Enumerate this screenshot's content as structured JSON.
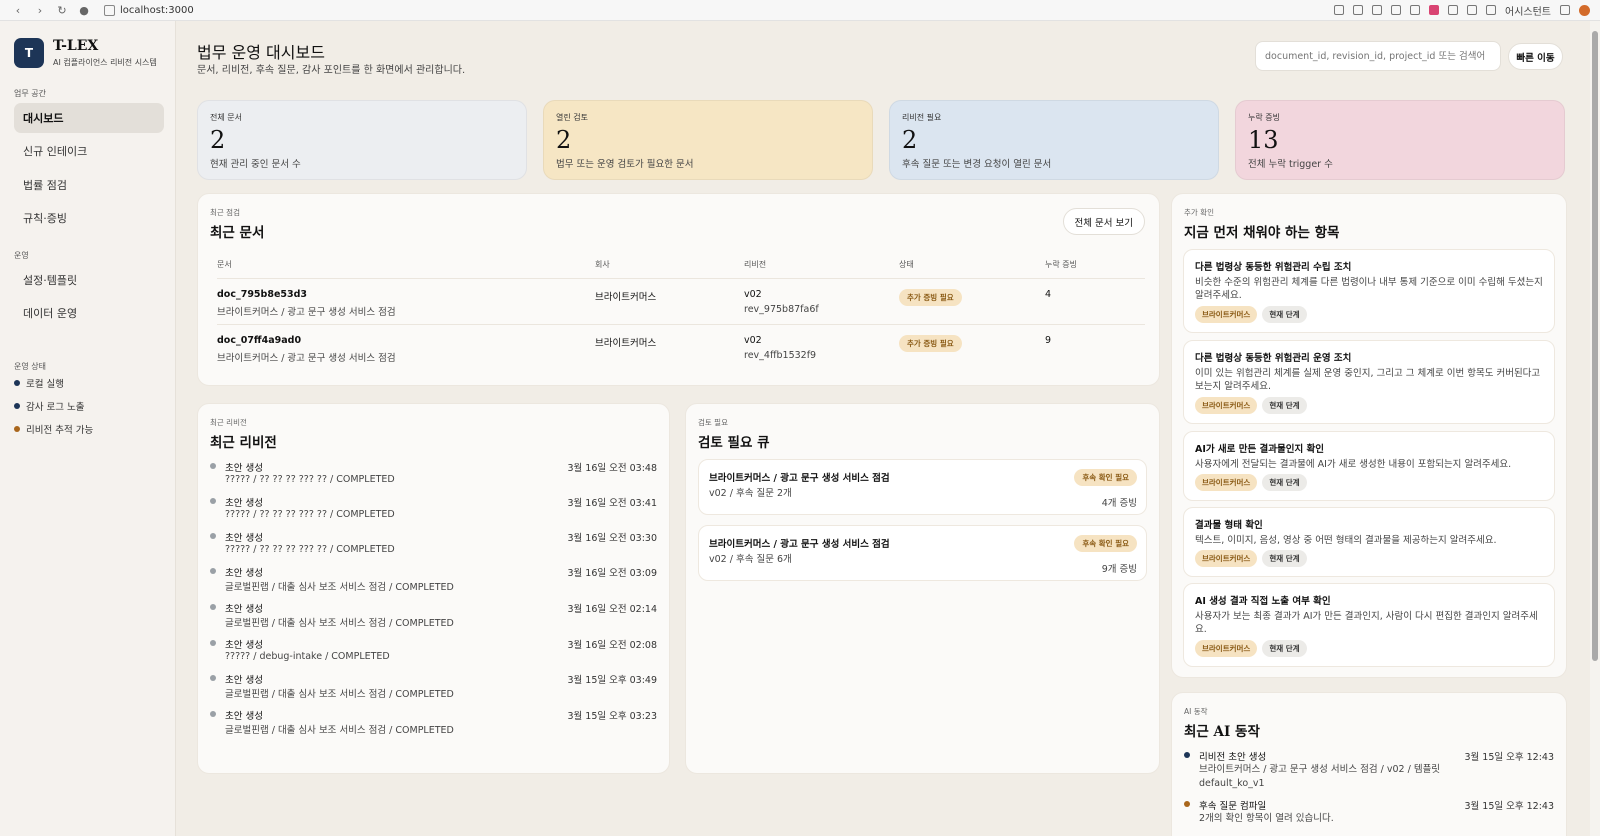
{
  "browser": {
    "url": "localhost:3000",
    "assistant_label": "어시스턴트"
  },
  "sidebar": {
    "logo_letter": "T",
    "brand": "T-LEX",
    "brand_sub": "AI 컴플라이언스 리비전 시스템",
    "section_workspace": "업무 공간",
    "workspace_items": [
      {
        "label": "대시보드",
        "active": true
      },
      {
        "label": "신규 인테이크"
      },
      {
        "label": "법률 점검"
      },
      {
        "label": "규칙·증빙"
      }
    ],
    "section_ops": "운영",
    "ops_items": [
      {
        "label": "설정·템플릿"
      },
      {
        "label": "데이터 운영"
      }
    ],
    "section_status": "운영 상태",
    "status_items": [
      {
        "label": "로컬 실행",
        "color": "#1d3557"
      },
      {
        "label": "감사 로그 노출",
        "color": "#1d3557"
      },
      {
        "label": "리비전 추적 가능",
        "color": "#a9661c"
      }
    ]
  },
  "header": {
    "title": "법무 운영 대시보드",
    "subtitle": "문서, 리비전, 후속 질문, 감사 포인트를 한 화면에서 관리합니다.",
    "search_placeholder": "document_id, revision_id, project_id 또는 검색어",
    "quick_button": "빠른 이동"
  },
  "stats": [
    {
      "label": "전체 문서",
      "value": "2",
      "desc": "현재 관리 중인 문서 수",
      "color": "#eceef1"
    },
    {
      "label": "열린 검토",
      "value": "2",
      "desc": "법무 또는 운영 검토가 필요한 문서",
      "color": "#f6e6c4"
    },
    {
      "label": "리비전 필요",
      "value": "2",
      "desc": "후속 질문 또는 변경 요청이 열린 문서",
      "color": "#dbe5f0"
    },
    {
      "label": "누락 증빙",
      "value": "13",
      "desc": "전체 누락 trigger 수",
      "color": "#f2d6dd"
    }
  ],
  "recent_docs": {
    "eyebrow": "최근 점검",
    "title": "최근 문서",
    "button": "전체 문서 보기",
    "columns": [
      "문서",
      "회사",
      "리비전",
      "상태",
      "누락 증빙"
    ],
    "rows": [
      {
        "doc_id": "doc_795b8e53d3",
        "doc_name": "브라이트커머스 / 광고 문구 생성 서비스 점검",
        "company": "브라이트커머스",
        "rev": "v02",
        "rev_id": "rev_975b87fa6f",
        "status": "추가 증빙 필요",
        "missing": "4"
      },
      {
        "doc_id": "doc_07ff4a9ad0",
        "doc_name": "브라이트커머스 / 광고 문구 생성 서비스 점검",
        "company": "브라이트커머스",
        "rev": "v02",
        "rev_id": "rev_4ffb1532f9",
        "status": "추가 증빙 필요",
        "missing": "9"
      }
    ]
  },
  "recent_revisions": {
    "eyebrow": "최근 리비전",
    "title": "최근 리비전",
    "items": [
      {
        "title": "초안 생성",
        "sub": "????? / ?? ?? ?? ??? ?? / COMPLETED",
        "time": "3월 16일 오전 03:48"
      },
      {
        "title": "초안 생성",
        "sub": "????? / ?? ?? ?? ??? ?? / COMPLETED",
        "time": "3월 16일 오전 03:41"
      },
      {
        "title": "초안 생성",
        "sub": "????? / ?? ?? ?? ??? ?? / COMPLETED",
        "time": "3월 16일 오전 03:30"
      },
      {
        "title": "초안 생성",
        "sub": "글로벌핀랩 / 대출 심사 보조 서비스 점검 / COMPLETED",
        "time": "3월 16일 오전 03:09"
      },
      {
        "title": "초안 생성",
        "sub": "글로벌핀랩 / 대출 심사 보조 서비스 점검 / COMPLETED",
        "time": "3월 16일 오전 02:14"
      },
      {
        "title": "초안 생성",
        "sub": "????? / debug-intake / COMPLETED",
        "time": "3월 16일 오전 02:08"
      },
      {
        "title": "초안 생성",
        "sub": "글로벌핀랩 / 대출 심사 보조 서비스 점검 / COMPLETED",
        "time": "3월 15일 오후 03:49"
      },
      {
        "title": "초안 생성",
        "sub": "글로벌핀랩 / 대출 심사 보조 서비스 점검 / COMPLETED",
        "time": "3월 15일 오후 03:23"
      }
    ]
  },
  "review_queue": {
    "eyebrow": "검토 필요",
    "title": "검토 필요 큐",
    "items": [
      {
        "title": "브라이트커머스 / 광고 문구 생성 서비스 점검",
        "sub": "v02 / 후속 질문 2개",
        "badge": "후속 확인 필요",
        "count": "4개 증빙"
      },
      {
        "title": "브라이트커머스 / 광고 문구 생성 서비스 점검",
        "sub": "v02 / 후속 질문 6개",
        "badge": "후속 확인 필요",
        "count": "9개 증빙"
      }
    ]
  },
  "followups": {
    "eyebrow": "추가 확인",
    "title": "지금 먼저 채워야 하는 항목",
    "items": [
      {
        "title": "다른 법령상 동등한 위험관리 수립 조치",
        "desc": "비슷한 수준의 위험관리 체계를 다른 법령이나 내부 통제 기준으로 이미 수립해 두셨는지 알려주세요.",
        "company": "브라이트커머스",
        "stage": "현재 단계"
      },
      {
        "title": "다른 법령상 동등한 위험관리 운영 조치",
        "desc": "이미 있는 위험관리 체계를 실제 운영 중인지, 그리고 그 체계로 이번 항목도 커버된다고 보는지 알려주세요.",
        "company": "브라이트커머스",
        "stage": "현재 단계"
      },
      {
        "title": "AI가 새로 만든 결과물인지 확인",
        "desc": "사용자에게 전달되는 결과물에 AI가 새로 생성한 내용이 포함되는지 알려주세요.",
        "company": "브라이트커머스",
        "stage": "현재 단계"
      },
      {
        "title": "결과물 형태 확인",
        "desc": "텍스트, 이미지, 음성, 영상 중 어떤 형태의 결과물을 제공하는지 알려주세요.",
        "company": "브라이트커머스",
        "stage": "현재 단계"
      },
      {
        "title": "AI 생성 결과 직접 노출 여부 확인",
        "desc": "사용자가 보는 최종 결과가 AI가 만든 결과인지, 사람이 다시 편집한 결과인지 알려주세요.",
        "company": "브라이트커머스",
        "stage": "현재 단계"
      }
    ]
  },
  "ai_actions": {
    "eyebrow": "AI 동작",
    "title": "최근 AI 동작",
    "items": [
      {
        "title": "리비전 초안 생성",
        "sub": "브라이트커머스 / 광고 문구 생성 서비스 점검 / v02 / 템플릿 default_ko_v1",
        "time": "3월 15일 오후 12:43",
        "color": "#1d3557"
      },
      {
        "title": "후속 질문 컴파일",
        "sub": "2개의 확인 항목이 열려 있습니다.",
        "time": "3월 15일 오후 12:43",
        "color": "#a9661c"
      }
    ]
  }
}
